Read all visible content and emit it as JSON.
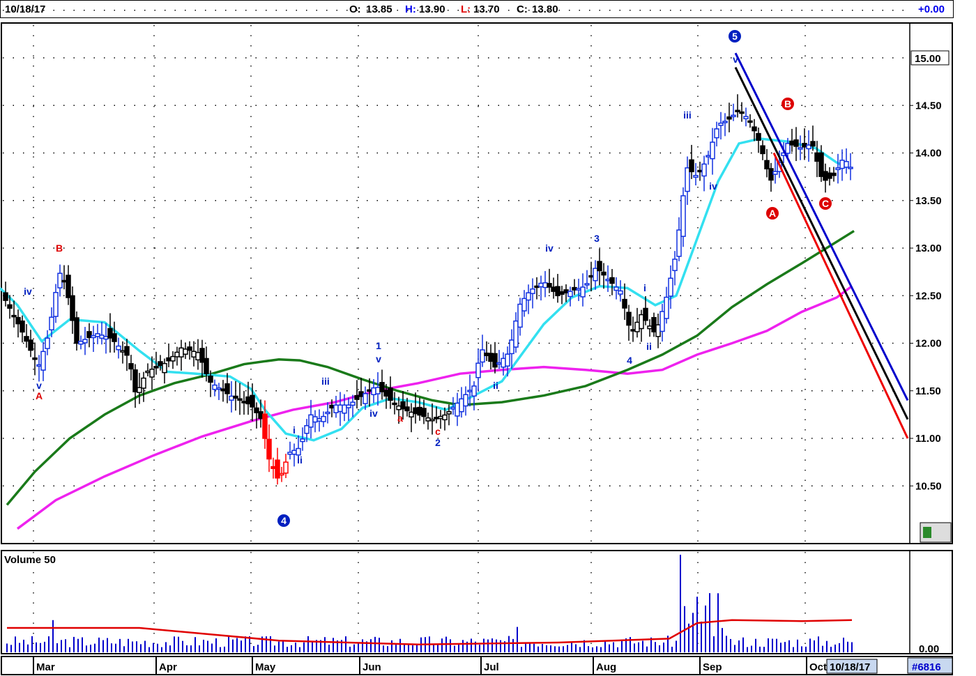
{
  "header": {
    "date": "10/18/17",
    "open_label": "O:",
    "open": "13.85",
    "high_label": "H:",
    "high": "13.90",
    "low_label": "L:",
    "low": "13.70",
    "close_label": "C:",
    "close": "13.80",
    "change": "+0.00"
  },
  "price_panel": {
    "last_price_tag": "15.00",
    "y_ticks": [
      "15.00",
      "14.50",
      "14.00",
      "13.50",
      "13.00",
      "12.50",
      "12.00",
      "11.50",
      "11.00",
      "10.50"
    ]
  },
  "volume_panel": {
    "title": "Volume 50",
    "y_tick": "0.00"
  },
  "x_axis": {
    "months": [
      "Mar",
      "Apr",
      "May",
      "Jun",
      "Jul",
      "Aug",
      "Sep",
      "Oct"
    ],
    "cursor_date": "10/18/17",
    "symbol": "#6816"
  },
  "wave_labels": {
    "circled": [
      "4",
      "5",
      "A",
      "B",
      "C"
    ],
    "minor": [
      "iv",
      "v",
      "A",
      "B",
      "i",
      "ii",
      "iii",
      "iv",
      "v",
      "1",
      "2",
      "3",
      "4",
      "a",
      "c",
      "ii",
      "iii",
      "iv",
      "v",
      "iv",
      "i",
      "ii"
    ]
  },
  "colors": {
    "up_bar": "#1030e0",
    "down_bar": "#000000",
    "red_bar": "#ff0000",
    "ma_fast": "#33e0f0",
    "ma_mid": "#1a7a1a",
    "ma_slow": "#ee22ee",
    "channel_blue": "#0000cc",
    "channel_red": "#ee0000",
    "volume_avg": "#e00000"
  },
  "chart_data": {
    "type": "candlestick",
    "ylim": [
      10.2,
      15.5
    ],
    "ma_fast": [
      [
        0,
        12.58
      ],
      [
        25,
        12.4
      ],
      [
        60,
        12.02
      ],
      [
        100,
        12.25
      ],
      [
        150,
        12.22
      ],
      [
        200,
        11.92
      ],
      [
        240,
        11.7
      ],
      [
        280,
        11.68
      ],
      [
        330,
        11.65
      ],
      [
        360,
        11.52
      ],
      [
        380,
        11.3
      ],
      [
        410,
        11.05
      ],
      [
        450,
        10.98
      ],
      [
        490,
        11.1
      ],
      [
        520,
        11.32
      ],
      [
        560,
        11.42
      ],
      [
        600,
        11.38
      ],
      [
        640,
        11.3
      ],
      [
        680,
        11.45
      ],
      [
        720,
        11.6
      ],
      [
        750,
        11.9
      ],
      [
        780,
        12.2
      ],
      [
        820,
        12.48
      ],
      [
        860,
        12.6
      ],
      [
        900,
        12.58
      ],
      [
        940,
        12.4
      ],
      [
        970,
        12.5
      ],
      [
        1000,
        13.1
      ],
      [
        1030,
        13.7
      ],
      [
        1060,
        14.1
      ],
      [
        1090,
        14.15
      ],
      [
        1130,
        14.12
      ],
      [
        1170,
        14.05
      ],
      [
        1200,
        13.9
      ],
      [
        1215,
        13.85
      ]
    ],
    "ma_mid": [
      [
        10,
        10.3
      ],
      [
        50,
        10.65
      ],
      [
        100,
        11.0
      ],
      [
        150,
        11.25
      ],
      [
        200,
        11.45
      ],
      [
        250,
        11.58
      ],
      [
        300,
        11.67
      ],
      [
        350,
        11.78
      ],
      [
        400,
        11.83
      ],
      [
        430,
        11.82
      ],
      [
        470,
        11.75
      ],
      [
        520,
        11.62
      ],
      [
        570,
        11.5
      ],
      [
        620,
        11.4
      ],
      [
        660,
        11.35
      ],
      [
        720,
        11.38
      ],
      [
        780,
        11.45
      ],
      [
        840,
        11.55
      ],
      [
        900,
        11.72
      ],
      [
        950,
        11.88
      ],
      [
        1000,
        12.08
      ],
      [
        1050,
        12.38
      ],
      [
        1100,
        12.62
      ],
      [
        1150,
        12.84
      ],
      [
        1190,
        13.02
      ],
      [
        1225,
        13.18
      ]
    ],
    "ma_slow": [
      [
        25,
        10.05
      ],
      [
        80,
        10.35
      ],
      [
        150,
        10.6
      ],
      [
        220,
        10.82
      ],
      [
        290,
        11.02
      ],
      [
        360,
        11.18
      ],
      [
        420,
        11.3
      ],
      [
        480,
        11.38
      ],
      [
        540,
        11.5
      ],
      [
        600,
        11.58
      ],
      [
        660,
        11.68
      ],
      [
        720,
        11.72
      ],
      [
        780,
        11.75
      ],
      [
        840,
        11.72
      ],
      [
        900,
        11.68
      ],
      [
        950,
        11.72
      ],
      [
        1000,
        11.88
      ],
      [
        1050,
        12.0
      ],
      [
        1100,
        12.13
      ],
      [
        1150,
        12.33
      ],
      [
        1200,
        12.48
      ],
      [
        1222,
        12.6
      ]
    ],
    "channel_lines": [
      {
        "color": "blue",
        "from": [
          1055,
          15.05
        ],
        "to": [
          1302,
          11.4
        ]
      },
      {
        "color": "black",
        "from": [
          1055,
          14.9
        ],
        "to": [
          1302,
          11.2
        ]
      },
      {
        "color": "red",
        "from": [
          1110,
          14.0
        ],
        "to": [
          1302,
          11.0
        ]
      }
    ],
    "volume_avg": [
      [
        10,
        0.25
      ],
      [
        200,
        0.25
      ],
      [
        400,
        0.12
      ],
      [
        600,
        0.08
      ],
      [
        800,
        0.1
      ],
      [
        960,
        0.14
      ],
      [
        1000,
        0.3
      ],
      [
        1050,
        0.33
      ],
      [
        1150,
        0.32
      ],
      [
        1222,
        0.33
      ]
    ]
  }
}
